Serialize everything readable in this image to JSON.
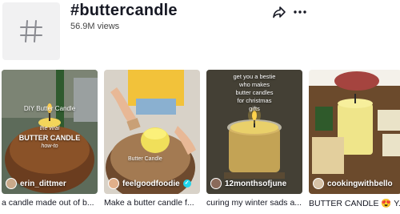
{
  "header": {
    "title": "#buttercandle",
    "views": "56.9M views",
    "hashtag_icon": "hashtag-icon",
    "share_icon": "share-icon",
    "more_icon": "more-icon"
  },
  "videos": [
    {
      "author": "erin_dittmer",
      "caption": "a candle made out of b...",
      "overlay_lines": [
        "DIY Butter Candle",
        "the viral",
        "BUTTER CANDLE",
        "how-to"
      ]
    },
    {
      "author": "feelgoodfoodie",
      "verified": true,
      "caption": "Make a butter candle f...",
      "overlay_lines": [
        "Butter Candle"
      ]
    },
    {
      "author": "12monthsofjune",
      "caption": "curing my winter sads a...",
      "overlay_lines": [
        "get you a bestie",
        "who makes",
        "butter candles",
        "for christmas",
        "gifts"
      ]
    },
    {
      "author": "cookingwithbello",
      "caption": "BUTTER CANDLE 😍 Y..."
    }
  ],
  "colors": {
    "text": "#161823",
    "secondary": "#444444",
    "verified": "#20d5ec"
  }
}
